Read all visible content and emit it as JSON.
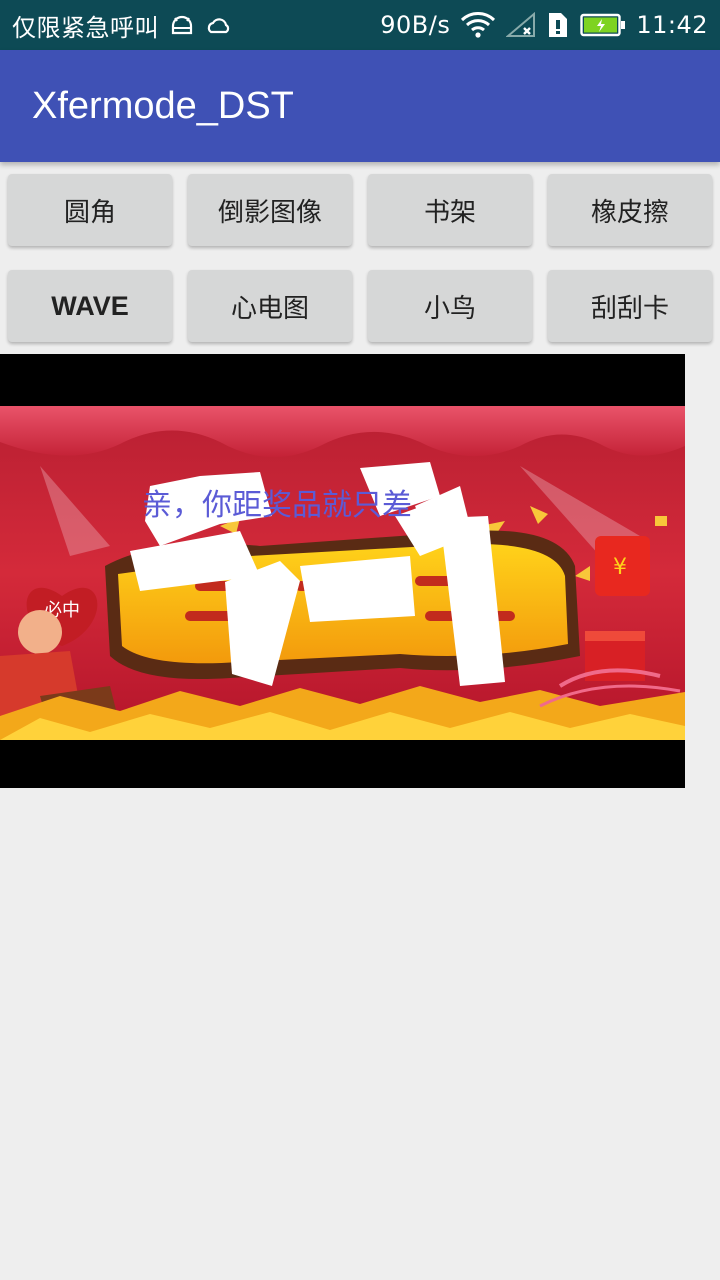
{
  "status_bar": {
    "notification_text": "仅限紧急呼叫",
    "net_speed": "90B/s",
    "time": "11:42",
    "battery_color": "#7ed321"
  },
  "app_bar": {
    "title": "Xfermode_DST",
    "color": "#3f51b5"
  },
  "buttons": [
    {
      "label": "圆角"
    },
    {
      "label": "倒影图像"
    },
    {
      "label": "书架"
    },
    {
      "label": "橡皮擦"
    },
    {
      "label": "WAVE"
    },
    {
      "label": "心电图"
    },
    {
      "label": "小鸟"
    },
    {
      "label": "刮刮卡"
    }
  ],
  "scratch_card": {
    "hidden_text": "亲，你距奖品就只差",
    "badge_text": "必中",
    "currency_symbol": "¥",
    "banner_color": "#c8202e"
  }
}
